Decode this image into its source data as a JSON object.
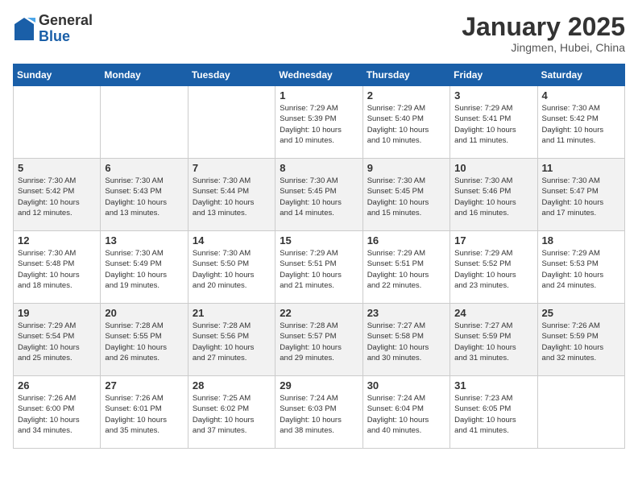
{
  "header": {
    "logo_general": "General",
    "logo_blue": "Blue",
    "month_title": "January 2025",
    "location": "Jingmen, Hubei, China"
  },
  "weekdays": [
    "Sunday",
    "Monday",
    "Tuesday",
    "Wednesday",
    "Thursday",
    "Friday",
    "Saturday"
  ],
  "weeks": [
    [
      {
        "day": "",
        "info": ""
      },
      {
        "day": "",
        "info": ""
      },
      {
        "day": "",
        "info": ""
      },
      {
        "day": "1",
        "info": "Sunrise: 7:29 AM\nSunset: 5:39 PM\nDaylight: 10 hours\nand 10 minutes."
      },
      {
        "day": "2",
        "info": "Sunrise: 7:29 AM\nSunset: 5:40 PM\nDaylight: 10 hours\nand 10 minutes."
      },
      {
        "day": "3",
        "info": "Sunrise: 7:29 AM\nSunset: 5:41 PM\nDaylight: 10 hours\nand 11 minutes."
      },
      {
        "day": "4",
        "info": "Sunrise: 7:30 AM\nSunset: 5:42 PM\nDaylight: 10 hours\nand 11 minutes."
      }
    ],
    [
      {
        "day": "5",
        "info": "Sunrise: 7:30 AM\nSunset: 5:42 PM\nDaylight: 10 hours\nand 12 minutes."
      },
      {
        "day": "6",
        "info": "Sunrise: 7:30 AM\nSunset: 5:43 PM\nDaylight: 10 hours\nand 13 minutes."
      },
      {
        "day": "7",
        "info": "Sunrise: 7:30 AM\nSunset: 5:44 PM\nDaylight: 10 hours\nand 13 minutes."
      },
      {
        "day": "8",
        "info": "Sunrise: 7:30 AM\nSunset: 5:45 PM\nDaylight: 10 hours\nand 14 minutes."
      },
      {
        "day": "9",
        "info": "Sunrise: 7:30 AM\nSunset: 5:45 PM\nDaylight: 10 hours\nand 15 minutes."
      },
      {
        "day": "10",
        "info": "Sunrise: 7:30 AM\nSunset: 5:46 PM\nDaylight: 10 hours\nand 16 minutes."
      },
      {
        "day": "11",
        "info": "Sunrise: 7:30 AM\nSunset: 5:47 PM\nDaylight: 10 hours\nand 17 minutes."
      }
    ],
    [
      {
        "day": "12",
        "info": "Sunrise: 7:30 AM\nSunset: 5:48 PM\nDaylight: 10 hours\nand 18 minutes."
      },
      {
        "day": "13",
        "info": "Sunrise: 7:30 AM\nSunset: 5:49 PM\nDaylight: 10 hours\nand 19 minutes."
      },
      {
        "day": "14",
        "info": "Sunrise: 7:30 AM\nSunset: 5:50 PM\nDaylight: 10 hours\nand 20 minutes."
      },
      {
        "day": "15",
        "info": "Sunrise: 7:29 AM\nSunset: 5:51 PM\nDaylight: 10 hours\nand 21 minutes."
      },
      {
        "day": "16",
        "info": "Sunrise: 7:29 AM\nSunset: 5:51 PM\nDaylight: 10 hours\nand 22 minutes."
      },
      {
        "day": "17",
        "info": "Sunrise: 7:29 AM\nSunset: 5:52 PM\nDaylight: 10 hours\nand 23 minutes."
      },
      {
        "day": "18",
        "info": "Sunrise: 7:29 AM\nSunset: 5:53 PM\nDaylight: 10 hours\nand 24 minutes."
      }
    ],
    [
      {
        "day": "19",
        "info": "Sunrise: 7:29 AM\nSunset: 5:54 PM\nDaylight: 10 hours\nand 25 minutes."
      },
      {
        "day": "20",
        "info": "Sunrise: 7:28 AM\nSunset: 5:55 PM\nDaylight: 10 hours\nand 26 minutes."
      },
      {
        "day": "21",
        "info": "Sunrise: 7:28 AM\nSunset: 5:56 PM\nDaylight: 10 hours\nand 27 minutes."
      },
      {
        "day": "22",
        "info": "Sunrise: 7:28 AM\nSunset: 5:57 PM\nDaylight: 10 hours\nand 29 minutes."
      },
      {
        "day": "23",
        "info": "Sunrise: 7:27 AM\nSunset: 5:58 PM\nDaylight: 10 hours\nand 30 minutes."
      },
      {
        "day": "24",
        "info": "Sunrise: 7:27 AM\nSunset: 5:59 PM\nDaylight: 10 hours\nand 31 minutes."
      },
      {
        "day": "25",
        "info": "Sunrise: 7:26 AM\nSunset: 5:59 PM\nDaylight: 10 hours\nand 32 minutes."
      }
    ],
    [
      {
        "day": "26",
        "info": "Sunrise: 7:26 AM\nSunset: 6:00 PM\nDaylight: 10 hours\nand 34 minutes."
      },
      {
        "day": "27",
        "info": "Sunrise: 7:26 AM\nSunset: 6:01 PM\nDaylight: 10 hours\nand 35 minutes."
      },
      {
        "day": "28",
        "info": "Sunrise: 7:25 AM\nSunset: 6:02 PM\nDaylight: 10 hours\nand 37 minutes."
      },
      {
        "day": "29",
        "info": "Sunrise: 7:24 AM\nSunset: 6:03 PM\nDaylight: 10 hours\nand 38 minutes."
      },
      {
        "day": "30",
        "info": "Sunrise: 7:24 AM\nSunset: 6:04 PM\nDaylight: 10 hours\nand 40 minutes."
      },
      {
        "day": "31",
        "info": "Sunrise: 7:23 AM\nSunset: 6:05 PM\nDaylight: 10 hours\nand 41 minutes."
      },
      {
        "day": "",
        "info": ""
      }
    ]
  ]
}
